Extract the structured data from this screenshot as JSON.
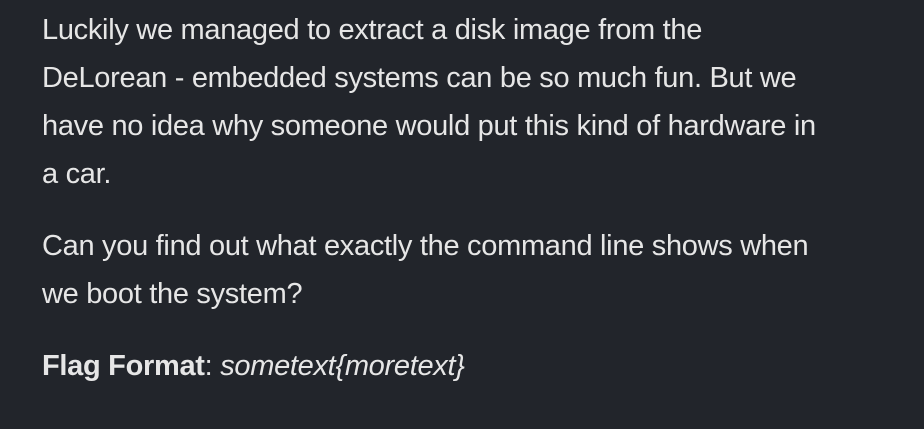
{
  "description": {
    "paragraph1": "Luckily we managed to extract a disk image from the DeLorean - embedded systems can be so much fun. But we have no idea why someone would put this kind of hardware in a car.",
    "paragraph2": "Can you find out what exactly the command line shows when we boot the system?",
    "flag_label": "Flag Format",
    "flag_separator": ": ",
    "flag_value": "sometext{moretext}"
  }
}
